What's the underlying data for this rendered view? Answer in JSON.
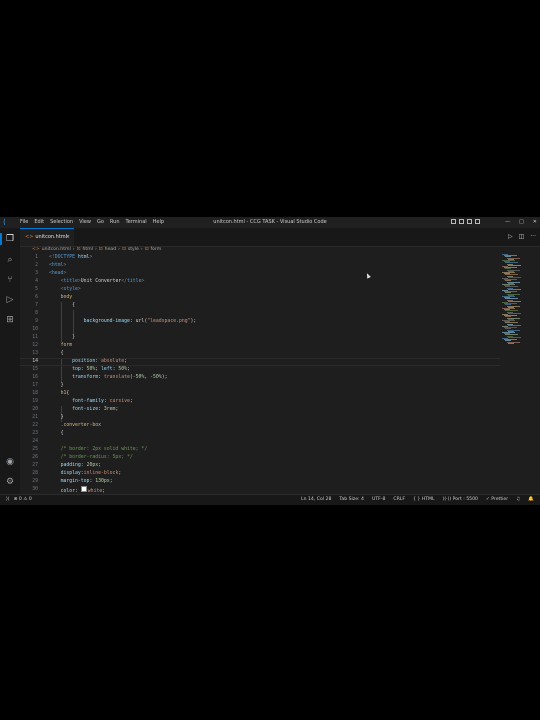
{
  "window": {
    "title": "unitcon.html - CCG TASK - Visual Studio Code",
    "menu": [
      "File",
      "Edit",
      "Selection",
      "View",
      "Go",
      "Run",
      "Terminal",
      "Help"
    ]
  },
  "tab": {
    "name": "unitcon.html",
    "close": "×"
  },
  "breadcrumb": [
    "unitcon.html",
    "html",
    "head",
    "style",
    "form"
  ],
  "code_lines": [
    {
      "n": "1",
      "parts": [
        [
          "punc",
          "<!"
        ],
        [
          "dtype",
          "DOCTYPE"
        ],
        [
          "prop",
          " html"
        ],
        [
          "punc",
          ">"
        ]
      ]
    },
    {
      "n": "2",
      "parts": [
        [
          "punc",
          "<"
        ],
        [
          "tag",
          "html"
        ],
        [
          "punc",
          ">"
        ]
      ]
    },
    {
      "n": "3",
      "parts": [
        [
          "punc",
          "<"
        ],
        [
          "tag",
          "head"
        ],
        [
          "punc",
          ">"
        ]
      ]
    },
    {
      "n": "4",
      "parts": [
        [
          "t",
          "    "
        ],
        [
          "punc",
          "<"
        ],
        [
          "tag",
          "title"
        ],
        [
          "punc",
          ">"
        ],
        [
          "t",
          "Unit Converter"
        ],
        [
          "punc",
          "</"
        ],
        [
          "tag",
          "title"
        ],
        [
          "punc",
          ">"
        ]
      ]
    },
    {
      "n": "5",
      "parts": [
        [
          "t",
          "    "
        ],
        [
          "punc",
          "<"
        ],
        [
          "tag",
          "style"
        ],
        [
          "punc",
          ">"
        ]
      ]
    },
    {
      "n": "6",
      "parts": [
        [
          "t",
          "    "
        ],
        [
          "sel",
          "body"
        ]
      ]
    },
    {
      "n": "7",
      "parts": [
        [
          "t",
          "        "
        ],
        [
          "t",
          "{"
        ]
      ]
    },
    {
      "n": "8",
      "parts": []
    },
    {
      "n": "9",
      "parts": [
        [
          "t",
          "            "
        ],
        [
          "prop",
          "background-image"
        ],
        [
          "t",
          ": "
        ],
        [
          "t",
          "url("
        ],
        [
          "val",
          "\"leadspace.png\""
        ],
        [
          "t",
          ");"
        ]
      ]
    },
    {
      "n": "10",
      "parts": []
    },
    {
      "n": "11",
      "parts": [
        [
          "t",
          "        "
        ],
        [
          "t",
          "}"
        ]
      ]
    },
    {
      "n": "12",
      "parts": [
        [
          "t",
          "    "
        ],
        [
          "sel",
          "form"
        ]
      ]
    },
    {
      "n": "13",
      "parts": [
        [
          "t",
          "    "
        ],
        [
          "t",
          "{"
        ]
      ]
    },
    {
      "n": "14",
      "parts": [
        [
          "t",
          "        "
        ],
        [
          "prop",
          "position"
        ],
        [
          "t",
          ": "
        ],
        [
          "val",
          "absolute"
        ],
        [
          "t",
          ";"
        ]
      ]
    },
    {
      "n": "15",
      "parts": [
        [
          "t",
          "        "
        ],
        [
          "prop",
          "top"
        ],
        [
          "t",
          ": "
        ],
        [
          "num",
          "50%"
        ],
        [
          "t",
          "; "
        ],
        [
          "prop",
          "left"
        ],
        [
          "t",
          ": "
        ],
        [
          "num",
          "50%"
        ],
        [
          "t",
          ";"
        ]
      ]
    },
    {
      "n": "16",
      "parts": [
        [
          "t",
          "        "
        ],
        [
          "prop",
          "transform"
        ],
        [
          "t",
          ": "
        ],
        [
          "val",
          "translate"
        ],
        [
          "t",
          "("
        ],
        [
          "num",
          "-50%"
        ],
        [
          "t",
          ", "
        ],
        [
          "num",
          "-50%"
        ],
        [
          "t",
          ");"
        ]
      ]
    },
    {
      "n": "17",
      "parts": [
        [
          "t",
          "    "
        ],
        [
          "t",
          "}"
        ]
      ]
    },
    {
      "n": "18",
      "parts": [
        [
          "t",
          "    "
        ],
        [
          "sel",
          "h1"
        ],
        [
          "t",
          "{"
        ]
      ]
    },
    {
      "n": "19",
      "parts": [
        [
          "t",
          "        "
        ],
        [
          "prop",
          "font-family"
        ],
        [
          "t",
          ": "
        ],
        [
          "val",
          "cursive"
        ],
        [
          "t",
          ";"
        ]
      ]
    },
    {
      "n": "20",
      "parts": [
        [
          "t",
          "        "
        ],
        [
          "prop",
          "font-size"
        ],
        [
          "t",
          ": "
        ],
        [
          "num",
          "3rem"
        ],
        [
          "t",
          ";"
        ]
      ]
    },
    {
      "n": "21",
      "parts": [
        [
          "t",
          "    "
        ],
        [
          "t",
          "}"
        ]
      ]
    },
    {
      "n": "22",
      "parts": [
        [
          "t",
          "    "
        ],
        [
          "sel",
          ".converter-box"
        ]
      ]
    },
    {
      "n": "23",
      "parts": [
        [
          "t",
          "    "
        ],
        [
          "t",
          "{"
        ]
      ]
    },
    {
      "n": "24",
      "parts": []
    },
    {
      "n": "25",
      "parts": [
        [
          "t",
          "    "
        ],
        [
          "cmt",
          "/* border: 2px solid white; */"
        ]
      ]
    },
    {
      "n": "26",
      "parts": [
        [
          "t",
          "    "
        ],
        [
          "cmt",
          "/* border-radius: 5px; */"
        ]
      ]
    },
    {
      "n": "27",
      "parts": [
        [
          "t",
          "    "
        ],
        [
          "prop",
          "padding"
        ],
        [
          "t",
          ": "
        ],
        [
          "num",
          "20px"
        ],
        [
          "t",
          ";"
        ]
      ]
    },
    {
      "n": "28",
      "parts": [
        [
          "t",
          "    "
        ],
        [
          "prop",
          "display"
        ],
        [
          "t",
          ":"
        ],
        [
          "val",
          "inline-block"
        ],
        [
          "t",
          ";"
        ]
      ]
    },
    {
      "n": "29",
      "parts": [
        [
          "t",
          "    "
        ],
        [
          "prop",
          "margin-top"
        ],
        [
          "t",
          ": "
        ],
        [
          "num",
          "130px"
        ],
        [
          "t",
          ";"
        ]
      ]
    },
    {
      "n": "30",
      "parts": [
        [
          "t",
          "    "
        ],
        [
          "prop",
          "color"
        ],
        [
          "t",
          ": "
        ],
        [
          "sw",
          "white"
        ],
        [
          "val",
          "white"
        ],
        [
          "t",
          ";"
        ]
      ]
    }
  ],
  "current_line": "14",
  "status": {
    "problems": "⊗ 0  ⚠ 0",
    "right": [
      "Ln 14, Col 28",
      "Tab Size: 4",
      "UTF-8",
      "CRLF",
      "{ } HTML",
      "((·)) Port : 5500",
      "✓ Prettier",
      "♫",
      "🔔"
    ]
  },
  "icons": {
    "explorer": "files-icon",
    "search": "search-icon",
    "scm": "source-control-icon",
    "run": "run-debug-icon",
    "extensions": "extensions-icon",
    "account": "account-icon",
    "settings": "gear-icon"
  }
}
